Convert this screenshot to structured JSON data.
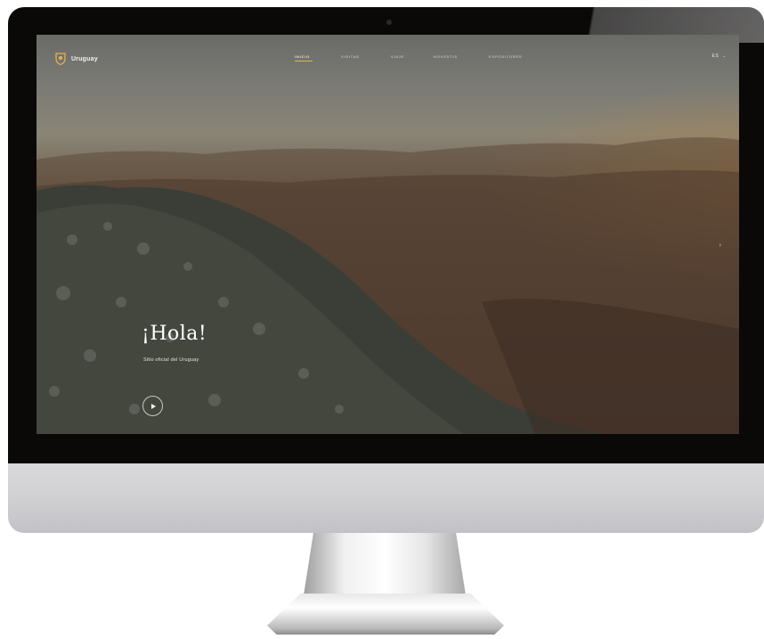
{
  "site": {
    "brand": "Uruguay",
    "nav_items": [
      "INICIO",
      "VISITAS",
      "VIAJE",
      "NOVEDTIS",
      "EXPOSITORES"
    ],
    "active_nav_index": 0,
    "language": "ES",
    "language_chevron": "⌄",
    "next_slide_glyph": "›"
  },
  "hero": {
    "title": "¡Hola!",
    "subtitle": "Sitio oficial del Uruguay",
    "play_icon": "play-icon"
  },
  "colors": {
    "accent": "#e7b24a",
    "bezel": "#0b0908",
    "chin": "#cfcfd2"
  }
}
